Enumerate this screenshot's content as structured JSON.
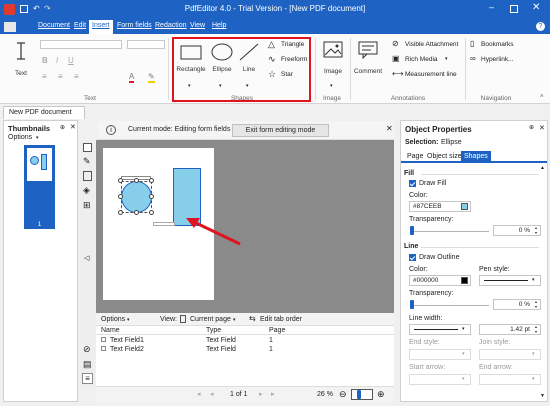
{
  "title": "PdfEditor 4.0 - Trial Version - [New PDF document]",
  "menu": [
    "Document",
    "Edit",
    "Insert",
    "Form fields",
    "Redaction",
    "View",
    "Help"
  ],
  "ribbon": {
    "text_label": "Text",
    "text_group": "Text",
    "shapes": {
      "rectangle": "Rectangle",
      "ellipse": "Ellipse",
      "line": "Line",
      "triangle": "Triangle",
      "freeform": "Freeform",
      "star": "Star",
      "group": "Shapes"
    },
    "image": {
      "label": "Image",
      "group": "Image"
    },
    "comment": "Comment",
    "annotations": {
      "visible_attachment": "Visible Attachment",
      "rich_media": "Rich Media",
      "measurement_line": "Measurement line",
      "group": "Annotations"
    },
    "navigation": {
      "bookmarks": "Bookmarks",
      "hyperlink": "Hyperlink...",
      "group": "Navigation"
    }
  },
  "doc_tab": "New PDF document",
  "thumbnails": {
    "title": "Thumbnails",
    "options": "Options",
    "page_num": "1"
  },
  "mode": {
    "text": "Current mode: Editing form fields",
    "exit_button": "Exit form editing mode"
  },
  "fields": {
    "options": "Options",
    "view_label": "View:",
    "view_value": "Current page",
    "edit_tab_order": "Edit tab order",
    "columns": [
      "Name",
      "Type",
      "Page"
    ],
    "rows": [
      [
        "Text Field1",
        "Text Field",
        "1"
      ],
      [
        "Text Field2",
        "Text Field",
        "1"
      ]
    ]
  },
  "status": {
    "page": "1 of 1",
    "zoom": "26 %"
  },
  "props": {
    "title": "Object Properties",
    "selection_label": "Selection:",
    "selection_value": "Ellipse",
    "tabs": [
      "Page",
      "Object size",
      "Shapes"
    ],
    "fill": {
      "header": "Fill",
      "draw_fill": "Draw Fill",
      "color_label": "Color:",
      "color_value": "#87CEEB",
      "transparency_label": "Transparency:",
      "transparency_value": "0 %",
      "swatch": "#87CEEB"
    },
    "line": {
      "header": "Line",
      "draw_outline": "Draw Outline",
      "color_label": "Color:",
      "color_value": "#000000",
      "pen_style": "Pen style:",
      "transparency_label": "Transparency:",
      "transparency_value": "0 %",
      "line_width": "Line width:",
      "line_width_value": "1.42 pt",
      "end_style": "End style:",
      "join_style": "Join style:",
      "start_arrow": "Start arrow:",
      "end_arrow": "End arrow:",
      "swatch": "#000000"
    }
  }
}
